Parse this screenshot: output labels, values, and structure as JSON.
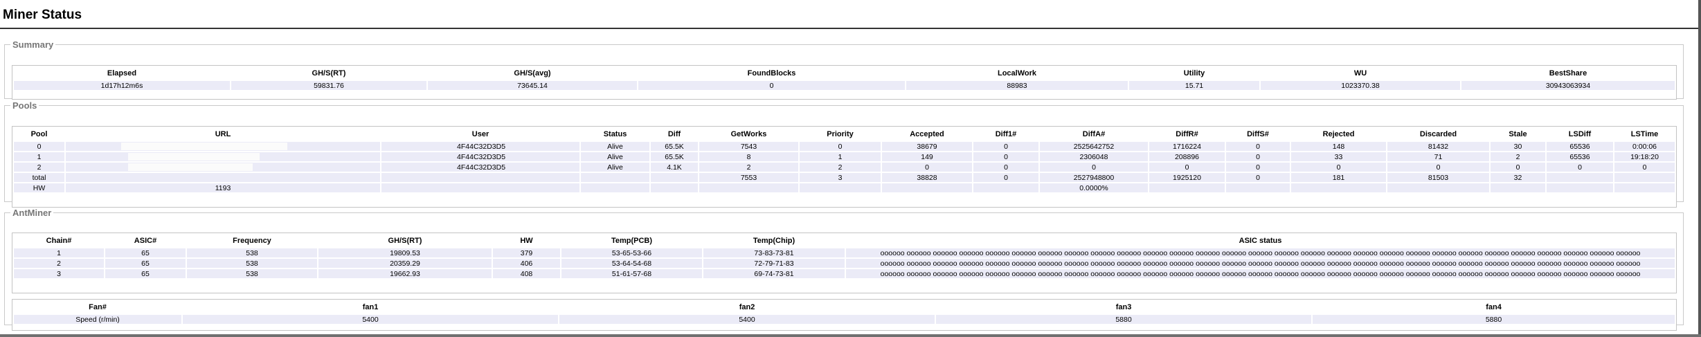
{
  "page": {
    "title": "Miner Status"
  },
  "summary": {
    "legend": "Summary",
    "headers": [
      "Elapsed",
      "GH/S(RT)",
      "GH/S(avg)",
      "FoundBlocks",
      "LocalWork",
      "Utility",
      "WU",
      "BestShare"
    ],
    "row": [
      "1d17h12m6s",
      "59831.76",
      "73645.14",
      "0",
      "88983",
      "15.71",
      "1023370.38",
      "30943063934"
    ]
  },
  "pools": {
    "legend": "Pools",
    "headers": [
      "Pool",
      "URL",
      "User",
      "Status",
      "Diff",
      "GetWorks",
      "Priority",
      "Accepted",
      "Diff1#",
      "DiffA#",
      "DiffR#",
      "DiffS#",
      "Rejected",
      "Discarded",
      "Stale",
      "LSDiff",
      "LSTime"
    ],
    "rows": [
      [
        "0",
        "",
        " 4F44C32D3D5",
        "Alive",
        "65.5K",
        "7543",
        "0",
        "38679",
        "0",
        "2525642752",
        "1716224",
        "0",
        "148",
        "81432",
        "30",
        "65536",
        "0:00:06"
      ],
      [
        "1",
        "",
        " 4F44C32D3D5",
        "Alive",
        "65.5K",
        "8",
        "1",
        "149",
        "0",
        "2306048",
        "208896",
        "0",
        "33",
        "71",
        "2",
        "65536",
        "19:18:20"
      ],
      [
        "2",
        "",
        " 4F44C32D3D5",
        "Alive",
        "4.1K",
        "2",
        "2",
        "0",
        "0",
        "0",
        "0",
        "0",
        "0",
        "0",
        "0",
        "0",
        "0"
      ],
      [
        "total",
        "",
        "",
        "",
        "",
        "7553",
        "3",
        "38828",
        "0",
        "2527948800",
        "1925120",
        "0",
        "181",
        "81503",
        "32",
        "",
        ""
      ],
      [
        "HW",
        "1193",
        "",
        "",
        "",
        "",
        "",
        "",
        "",
        "0.0000%",
        "",
        "",
        "",
        "",
        "",
        "",
        ""
      ]
    ]
  },
  "antminer": {
    "legend": "AntMiner",
    "headers": [
      "Chain#",
      "ASIC#",
      "Frequency",
      "GH/S(RT)",
      "HW",
      "Temp(PCB)",
      "Temp(Chip)",
      "ASIC status"
    ],
    "rows": [
      [
        "1",
        "65",
        "538",
        "19809.53",
        "379",
        "53-65-53-66",
        "73-83-73-81",
        "oooooo oooooo oooooo oooooo oooooo oooooo oooooo oooooo oooooo oooooo oooooo oooooo oooooo oooooo oooooo oooooo oooooo oooooo oooooo oooooo oooooo oooooo oooooo oooooo oooooo oooooo oooooo oooooo oooooo"
      ],
      [
        "2",
        "65",
        "538",
        "20359.29",
        "406",
        "53-64-54-68",
        "72-79-71-83",
        "oooooo oooooo oooooo oooooo oooooo oooooo oooooo oooooo oooooo oooooo oooooo oooooo oooooo oooooo oooooo oooooo oooooo oooooo oooooo oooooo oooooo oooooo oooooo oooooo oooooo oooooo oooooo oooooo oooooo"
      ],
      [
        "3",
        "65",
        "538",
        "19662.93",
        "408",
        "51-61-57-68",
        "69-74-73-81",
        "oooooo oooooo oooooo oooooo oooooo oooooo oooooo oooooo oooooo oooooo oooooo oooooo oooooo oooooo oooooo oooooo oooooo oooooo oooooo oooooo oooooo oooooo oooooo oooooo oooooo oooooo oooooo oooooo oooooo"
      ]
    ]
  },
  "fans": {
    "headers": [
      "Fan#",
      "fan1",
      "fan2",
      "fan3",
      "fan4"
    ],
    "row": [
      "Speed (r/min)",
      "5400",
      "5400",
      "5880",
      "5880"
    ]
  }
}
